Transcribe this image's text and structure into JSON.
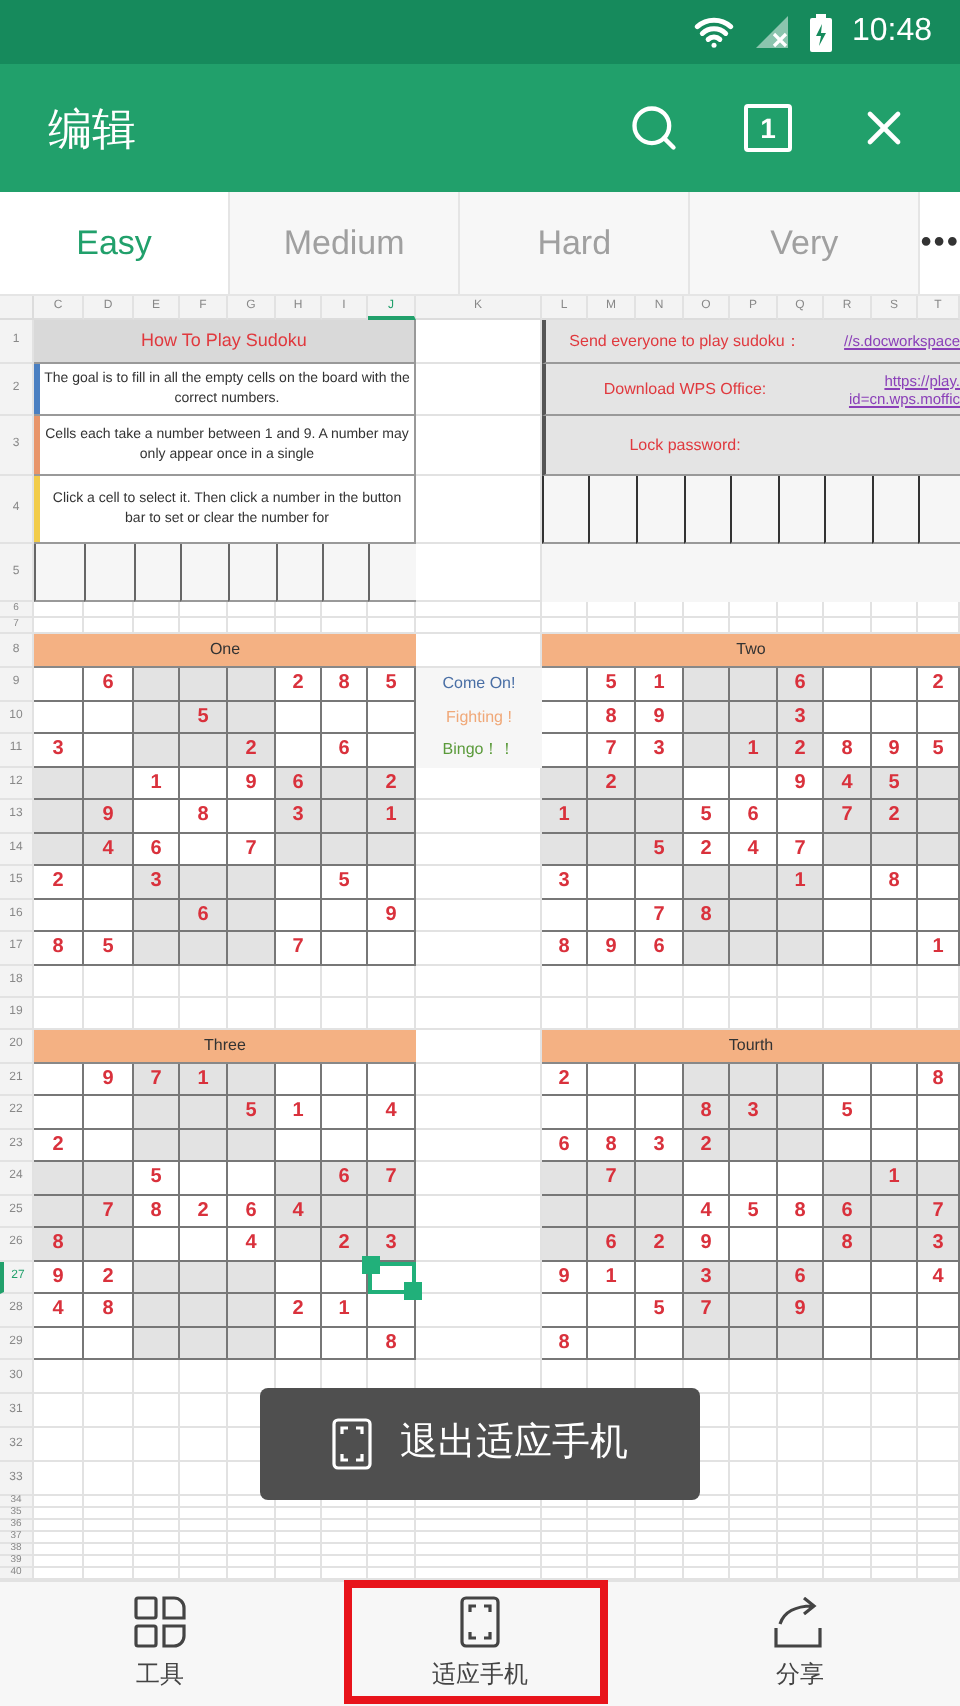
{
  "status_bar": {
    "time": "10:48"
  },
  "app_bar": {
    "title": "编辑",
    "page_count": "1"
  },
  "tabs": [
    {
      "label": "Easy",
      "selected": true
    },
    {
      "label": "Medium",
      "selected": false
    },
    {
      "label": "Hard",
      "selected": false
    },
    {
      "label": "Very",
      "selected": false
    }
  ],
  "more_tabs": "•••",
  "sheet": {
    "columns": [
      {
        "label": "C",
        "selected": false
      },
      {
        "label": "D",
        "selected": false
      },
      {
        "label": "E",
        "selected": false
      },
      {
        "label": "F",
        "selected": false
      },
      {
        "label": "G",
        "selected": false
      },
      {
        "label": "H",
        "selected": false
      },
      {
        "label": "I",
        "selected": false
      },
      {
        "label": "J",
        "selected": true
      },
      {
        "label": "K",
        "selected": false
      },
      {
        "label": "L",
        "selected": false
      },
      {
        "label": "M",
        "selected": false
      },
      {
        "label": "N",
        "selected": false
      },
      {
        "label": "O",
        "selected": false
      },
      {
        "label": "P",
        "selected": false
      },
      {
        "label": "Q",
        "selected": false
      },
      {
        "label": "R",
        "selected": false
      },
      {
        "label": "S",
        "selected": false
      },
      {
        "label": "T",
        "selected": false
      }
    ],
    "rows": [
      {
        "label": "1",
        "selected": false
      },
      {
        "label": "2",
        "selected": false
      },
      {
        "label": "3",
        "selected": false
      },
      {
        "label": "4",
        "selected": false
      },
      {
        "label": "5",
        "selected": false
      },
      {
        "label": "6",
        "selected": false
      },
      {
        "label": "7",
        "selected": false
      },
      {
        "label": "8",
        "selected": false
      },
      {
        "label": "9",
        "selected": false
      },
      {
        "label": "10",
        "selected": false
      },
      {
        "label": "11",
        "selected": false
      },
      {
        "label": "12",
        "selected": false
      },
      {
        "label": "13",
        "selected": false
      },
      {
        "label": "14",
        "selected": false
      },
      {
        "label": "15",
        "selected": false
      },
      {
        "label": "16",
        "selected": false
      },
      {
        "label": "17",
        "selected": false
      },
      {
        "label": "18",
        "selected": false
      },
      {
        "label": "19",
        "selected": false
      },
      {
        "label": "20",
        "selected": false
      },
      {
        "label": "21",
        "selected": false
      },
      {
        "label": "22",
        "selected": false
      },
      {
        "label": "23",
        "selected": false
      },
      {
        "label": "24",
        "selected": false
      },
      {
        "label": "25",
        "selected": false
      },
      {
        "label": "26",
        "selected": false
      },
      {
        "label": "27",
        "selected": true
      },
      {
        "label": "28",
        "selected": false
      },
      {
        "label": "29",
        "selected": false
      },
      {
        "label": "30",
        "selected": false
      },
      {
        "label": "31",
        "selected": false
      },
      {
        "label": "32",
        "selected": false
      },
      {
        "label": "33",
        "selected": false
      },
      {
        "label": "34",
        "selected": false
      },
      {
        "label": "35",
        "selected": false
      },
      {
        "label": "36",
        "selected": false
      },
      {
        "label": "37",
        "selected": false
      },
      {
        "label": "38",
        "selected": false
      },
      {
        "label": "39",
        "selected": false
      },
      {
        "label": "40",
        "selected": false
      }
    ],
    "instructions": {
      "title": "How To Play Sudoku",
      "notes": [
        {
          "text": "The goal is to fill in all the empty cells on the board with the correct numbers.",
          "color": "#4a7fc1"
        },
        {
          "text": "Cells each take a number between 1 and 9. A number may only appear once in a single",
          "color": "#e8956a"
        },
        {
          "text": "Click a cell to select it. Then click a number in the button bar to set or clear the number for",
          "color": "#f2cc4a"
        }
      ]
    },
    "info": [
      {
        "label": "Send everyone to play sudoku：",
        "link": [
          "//s.docworkspace"
        ]
      },
      {
        "label": "Download WPS Office:",
        "link": [
          "https://play.",
          "id=cn.wps.moffic"
        ]
      },
      {
        "label": "Lock password:"
      }
    ],
    "cheers": [
      {
        "text": "Come On!",
        "color": "#4a6fa5"
      },
      {
        "text": "Fighting !",
        "color": "#f0a878"
      },
      {
        "text": "Bingo！！",
        "color": "#5a9a3a"
      }
    ],
    "puzzles": [
      {
        "title": "One",
        "cells": [
          [
            null,
            "6",
            null,
            null,
            null,
            "2",
            "8",
            "5"
          ],
          [
            null,
            null,
            null,
            "5",
            null,
            null,
            null,
            null
          ],
          [
            "3",
            null,
            null,
            null,
            "2",
            null,
            "6",
            null
          ],
          [
            null,
            null,
            "1",
            null,
            "9",
            "6",
            null,
            "2"
          ],
          [
            null,
            "9",
            null,
            "8",
            null,
            "3",
            null,
            "1"
          ],
          [
            null,
            "4",
            "6",
            null,
            "7",
            null,
            null,
            null
          ],
          [
            "2",
            null,
            "3",
            null,
            null,
            null,
            "5",
            null
          ],
          [
            null,
            null,
            null,
            "6",
            null,
            null,
            null,
            "9"
          ],
          [
            "8",
            "5",
            null,
            null,
            null,
            "7",
            null,
            null
          ]
        ]
      },
      {
        "title": "Two",
        "cells": [
          [
            null,
            "5",
            "1",
            null,
            null,
            "6",
            null,
            null,
            "2"
          ],
          [
            null,
            "8",
            "9",
            null,
            null,
            "3",
            null,
            null,
            null
          ],
          [
            null,
            "7",
            "3",
            null,
            "1",
            "2",
            "8",
            "9",
            "5"
          ],
          [
            null,
            "2",
            null,
            null,
            null,
            "9",
            "4",
            "5",
            null
          ],
          [
            "1",
            null,
            null,
            "5",
            "6",
            null,
            "7",
            "2",
            null
          ],
          [
            null,
            null,
            "5",
            "2",
            "4",
            "7",
            null,
            null,
            null
          ],
          [
            "3",
            null,
            null,
            null,
            null,
            "1",
            null,
            "8",
            null
          ],
          [
            null,
            null,
            "7",
            "8",
            null,
            null,
            null,
            null,
            null
          ],
          [
            "8",
            "9",
            "6",
            null,
            null,
            null,
            null,
            null,
            "1"
          ]
        ]
      },
      {
        "title": "Three",
        "cells": [
          [
            null,
            "9",
            "7",
            "1",
            null,
            null,
            null,
            null
          ],
          [
            null,
            null,
            null,
            null,
            "5",
            "1",
            null,
            "4"
          ],
          [
            "2",
            null,
            null,
            null,
            null,
            null,
            null,
            null
          ],
          [
            null,
            null,
            "5",
            null,
            null,
            null,
            "6",
            "7"
          ],
          [
            null,
            "7",
            "8",
            "2",
            "6",
            "4",
            null,
            null
          ],
          [
            "8",
            null,
            null,
            null,
            "4",
            null,
            "2",
            "3"
          ],
          [
            "9",
            "2",
            null,
            null,
            null,
            null,
            null,
            null
          ],
          [
            "4",
            "8",
            null,
            null,
            null,
            "2",
            "1",
            null
          ],
          [
            null,
            null,
            null,
            null,
            null,
            null,
            null,
            "8"
          ]
        ]
      },
      {
        "title": "Tourth",
        "cells": [
          [
            "2",
            null,
            null,
            null,
            null,
            null,
            null,
            null,
            "8"
          ],
          [
            null,
            null,
            null,
            "8",
            "3",
            null,
            "5",
            null,
            null
          ],
          [
            "6",
            "8",
            "3",
            "2",
            null,
            null,
            null,
            null,
            null
          ],
          [
            null,
            "7",
            null,
            null,
            null,
            null,
            null,
            "1",
            null
          ],
          [
            null,
            null,
            null,
            "4",
            "5",
            "8",
            "6",
            null,
            "7"
          ],
          [
            null,
            "6",
            "2",
            "9",
            null,
            null,
            "8",
            null,
            "3"
          ],
          [
            "9",
            "1",
            null,
            "3",
            null,
            "6",
            null,
            null,
            "4"
          ],
          [
            null,
            null,
            "5",
            "7",
            null,
            "9",
            null,
            null,
            null
          ],
          [
            "8",
            null,
            null,
            null,
            null,
            null,
            null,
            null,
            null
          ]
        ]
      }
    ]
  },
  "toast": {
    "text": "退出适应手机"
  },
  "bottom_bar": [
    {
      "label": "工具",
      "kind": "tools",
      "highlighted": false
    },
    {
      "label": "适应手机",
      "kind": "fit",
      "highlighted": true
    },
    {
      "label": "分享",
      "kind": "share",
      "highlighted": false
    }
  ]
}
